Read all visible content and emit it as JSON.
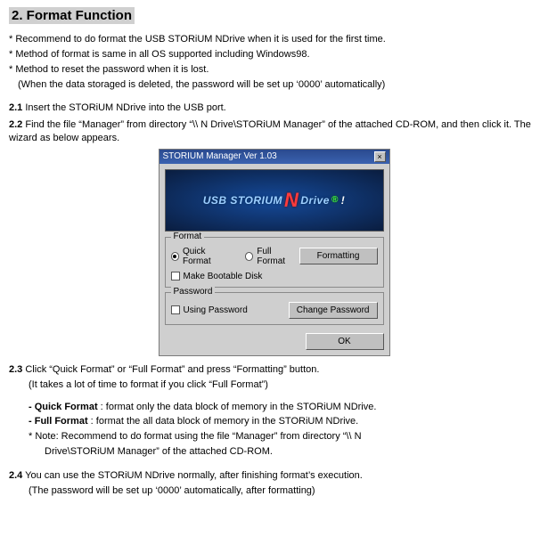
{
  "title": "2. Format Function",
  "intro": [
    "* Recommend to do format the USB STORiUM NDrive when it is used for the first time.",
    "* Method of format is same in all OS supported including Windows98.",
    "* Method to reset the password when it is lost.",
    "  (When the data storaged is deleted, the password will be set up ‘0000’ automatically)"
  ],
  "steps": {
    "s21": {
      "num": "2.1",
      "text": "Insert the STORiUM NDrive into the USB port."
    },
    "s22": {
      "num": "2.2",
      "text": "Find the file “Manager” from directory “\\\\ N Drive\\STORiUM Manager” of the attached CD-ROM, and then click it. The wizard as below appears."
    },
    "s23": {
      "num": "2.3",
      "text": " Click “Quick Format” or “Full Format” and press “Formatting” button."
    },
    "s23b": "(It takes a lot of time to format if you click “Full Format”)",
    "s24": {
      "num": "2.4",
      "text": "You can use the STORiUM NDrive normally, after finishing format’s execution."
    },
    "s24b": "(The password will be set up ‘0000’ automatically, after formatting)"
  },
  "bullets23": {
    "quick_label": "- Quick Format",
    "quick_text": " : format only the data block of memory in the STORiUM NDrive.",
    "full_label": "- Full Format",
    "full_text": " : format the all data block of memory in the STORiUM NDrive.",
    "note1": "* Note: Recommend to do format using the file “Manager” from directory “\\\\ N",
    "note2": "Drive\\STORiUM Manager” of the attached CD-ROM."
  },
  "wizard": {
    "titlebar": "STORIUM Manager Ver 1.03",
    "banner_a": "USB STORIUM",
    "banner_b": "Drive",
    "banner_r": "®",
    "excl": "!",
    "format_legend": "Format",
    "quick": "Quick Format",
    "full": "Full Format",
    "bootable": "Make Bootable Disk",
    "formatting_btn": "Formatting",
    "password_legend": "Password",
    "using_password": "Using Password",
    "change_pw_btn": "Change Password",
    "ok_btn": "OK"
  }
}
